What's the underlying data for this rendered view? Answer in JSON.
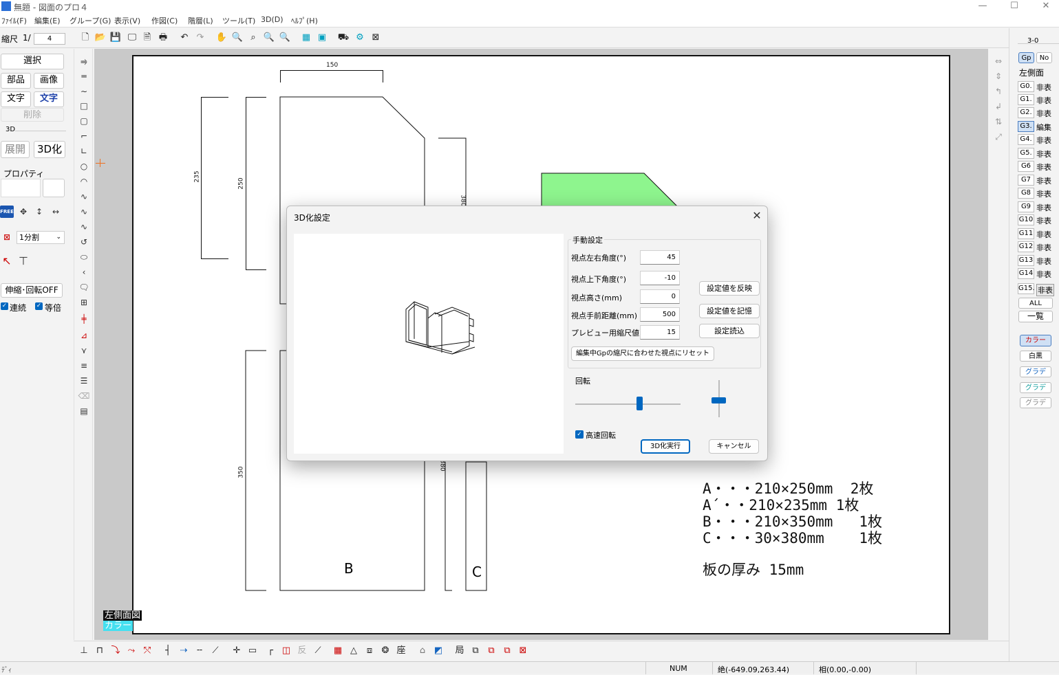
{
  "window": {
    "title": "無題 - 図面のプロ４",
    "controls": [
      "—",
      "☐",
      "✕"
    ]
  },
  "menu": [
    "ﾌｧｲﾙ(F)",
    "編集(E)",
    "グループ(G)",
    "表示(V)",
    "作図(C)",
    "階層(L)",
    "ツール(T)",
    "3D(D)",
    "ﾍﾙﾌﾟ(H)"
  ],
  "toolbar": {
    "scale_label": "縮尺",
    "scale_prefix": "1/",
    "scale_value": "4"
  },
  "left_panel": {
    "select": "選択",
    "parts": "部品",
    "image": "画像",
    "text": "文字",
    "text2": "文字",
    "delete": "削除",
    "section_3d": "3D",
    "unfold": "展開",
    "to3d": "3D化",
    "property": "プロパティ",
    "free": "FREE",
    "split": "1分割",
    "stretch": "伸縮･回転OFF",
    "continuous": "連続",
    "equal": "等倍"
  },
  "drawing": {
    "dim_150": "150",
    "dim_235": "235",
    "dim_250": "250",
    "dim_350": "350",
    "dim_380a": "380",
    "dim_380b": "380",
    "label_b": "B",
    "label_c": "C",
    "spec_lines": [
      "A・・・210×250mm  2枚",
      "A´・・210×235mm 1枚",
      "B・・・210×350mm   1枚",
      "C・・・30×380mm    1枚"
    ],
    "thickness": "板の厚み 15mm",
    "view_name": "左側面図",
    "color_mode": "カラー"
  },
  "right_panel": {
    "header": "3-0",
    "gp": "Gp",
    "no": "No",
    "view": "左側面",
    "groups": [
      {
        "name": "G0.",
        "state": "非表"
      },
      {
        "name": "G1.",
        "state": "非表"
      },
      {
        "name": "G2.",
        "state": "非表"
      },
      {
        "name": "G3.",
        "state": "編集"
      },
      {
        "name": "G4.",
        "state": "非表"
      },
      {
        "name": "G5.",
        "state": "非表"
      },
      {
        "name": "G6",
        "state": "非表"
      },
      {
        "name": "G7",
        "state": "非表"
      },
      {
        "name": "G8",
        "state": "非表"
      },
      {
        "name": "G9",
        "state": "非表"
      },
      {
        "name": "G10",
        "state": "非表"
      },
      {
        "name": "G11",
        "state": "非表"
      },
      {
        "name": "G12",
        "state": "非表"
      },
      {
        "name": "G13",
        "state": "非表"
      },
      {
        "name": "G14",
        "state": "非表"
      },
      {
        "name": "G15.",
        "state": "非表"
      }
    ],
    "all": "ALL",
    "list": "一覧",
    "color": "カラー",
    "bw": "白黒",
    "grad1": "グラデ",
    "grad2": "グラデ",
    "grad3": "グラデ"
  },
  "dialog": {
    "title": "3D化設定",
    "group_manual": "手動設定",
    "fields": [
      {
        "label": "視点左右角度(°)",
        "value": "45"
      },
      {
        "label": "視点上下角度(°)",
        "value": "-10"
      },
      {
        "label": "視点高さ(mm)",
        "value": "0"
      },
      {
        "label": "視点手前距離(mm)",
        "value": "500"
      },
      {
        "label": "プレビュー用縮尺値",
        "value": "15"
      }
    ],
    "apply_btn": "設定値を反映",
    "save_btn": "設定値を記憶",
    "load_btn": "設定読込",
    "reset_btn": "編集中Gpの縮尺に合わせた視点にリセット",
    "rotate_label": "回転",
    "fast_rotate": "高速回転",
    "run_btn": "3D化実行",
    "cancel_btn": "キャンセル",
    "accent": "#0067c0"
  },
  "status": {
    "mode": "ﾃﾞｨ",
    "num": "NUM",
    "abs_coord": "絶(-649.09,263.44)",
    "rel_coord": "相(0.00,-0.00)"
  }
}
